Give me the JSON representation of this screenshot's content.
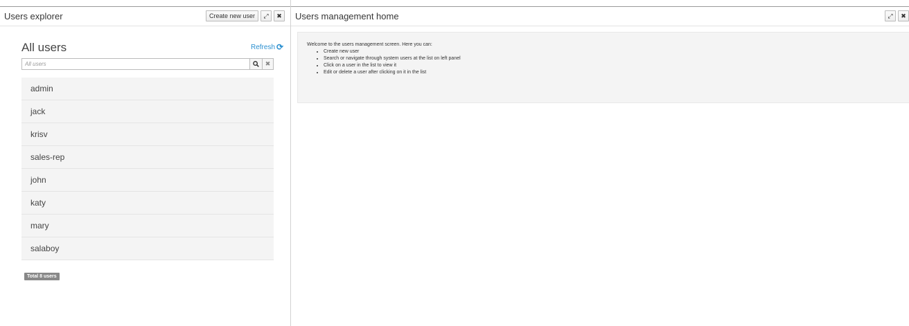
{
  "left_panel": {
    "title": "Users explorer",
    "create_button": "Create new user",
    "heading": "All users",
    "refresh_label": "Refresh",
    "search_placeholder": "All users",
    "users": [
      "admin",
      "jack",
      "krisv",
      "sales-rep",
      "john",
      "katy",
      "mary",
      "salaboy"
    ],
    "total_label": "Total 8 users"
  },
  "right_panel": {
    "title": "Users management home",
    "welcome_intro": "Welcome to the users management screen. Here you can:",
    "bullets": [
      "Create new user",
      "Search or navigate through system users at the list on left panel",
      "Click on a user in the list to view it",
      "Edit or delete a user after clicking on it in the list"
    ]
  },
  "icons": {
    "maximize": "maximize-icon",
    "close": "close-icon",
    "refresh": "refresh-icon",
    "search": "search-icon",
    "clear": "clear-icon"
  },
  "colors": {
    "accent": "#2a8fd0",
    "list_bg": "#f4f4f4",
    "badge_bg": "#888888"
  }
}
